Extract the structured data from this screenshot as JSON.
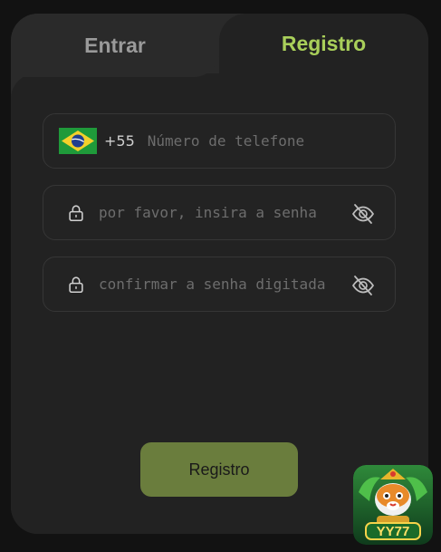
{
  "tabs": {
    "login_label": "Entrar",
    "register_label": "Registro",
    "active": "register"
  },
  "phone": {
    "country_code": "+55",
    "placeholder": "Número de telefone",
    "flag_icon": "brazil-flag-icon"
  },
  "password": {
    "placeholder": "por favor, insira a senha",
    "icon": "lock-icon",
    "toggle_icon": "eye-off-icon"
  },
  "confirm_password": {
    "placeholder": "confirmar a senha digitada",
    "icon": "lock-icon",
    "toggle_icon": "eye-off-icon"
  },
  "submit": {
    "label": "Registro"
  },
  "badge": {
    "text": "YY77"
  },
  "colors": {
    "accent": "#a9cf5a",
    "button": "#6a7d3d",
    "panel": "#2a2a2a",
    "form_bg": "#222222"
  }
}
